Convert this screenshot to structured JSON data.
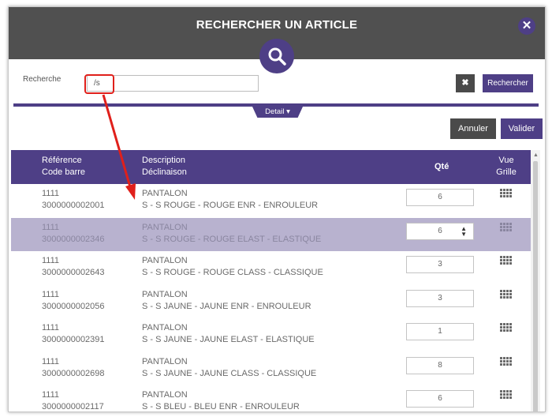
{
  "dialog": {
    "title": "RECHERCHER UN ARTICLE",
    "close_label": "✕",
    "search_label": "Recherche",
    "search_value": "/s",
    "clear_label": "✖",
    "search_button": "Rechercher",
    "detail_tab": "Detail ▾",
    "cancel_button": "Annuler",
    "validate_button": "Valider"
  },
  "table": {
    "headers": {
      "ref_line1": "Référence",
      "ref_line2": "Code barre",
      "desc_line1": "Description",
      "desc_line2": "Déclinaison",
      "qte": "Qté",
      "vue_line1": "Vue",
      "vue_line2": "Grille"
    },
    "rows": [
      {
        "ref": "1111",
        "barcode": "3000000002001",
        "desc": "PANTALON",
        "variant": "S - S ROUGE - ROUGE ENR - ENROULEUR",
        "qty": "6",
        "selected": false
      },
      {
        "ref": "1111",
        "barcode": "3000000002346",
        "desc": "PANTALON",
        "variant": "S - S ROUGE - ROUGE ELAST - ELASTIQUE",
        "qty": "6",
        "selected": true
      },
      {
        "ref": "1111",
        "barcode": "3000000002643",
        "desc": "PANTALON",
        "variant": "S - S ROUGE - ROUGE CLASS - CLASSIQUE",
        "qty": "3",
        "selected": false
      },
      {
        "ref": "1111",
        "barcode": "3000000002056",
        "desc": "PANTALON",
        "variant": "S - S JAUNE - JAUNE ENR - ENROULEUR",
        "qty": "3",
        "selected": false
      },
      {
        "ref": "1111",
        "barcode": "3000000002391",
        "desc": "PANTALON",
        "variant": "S - S JAUNE - JAUNE ELAST - ELASTIQUE",
        "qty": "1",
        "selected": false
      },
      {
        "ref": "1111",
        "barcode": "3000000002698",
        "desc": "PANTALON",
        "variant": "S - S JAUNE - JAUNE CLASS - CLASSIQUE",
        "qty": "8",
        "selected": false
      },
      {
        "ref": "1111",
        "barcode": "3000000002117",
        "desc": "PANTALON",
        "variant": "S - S BLEU - BLEU ENR - ENROULEUR",
        "qty": "6",
        "selected": false
      }
    ]
  },
  "colors": {
    "accent": "#4e3f86",
    "header_bg": "#505050",
    "annotation_red": "#e0201b",
    "selected_row": "#b8b2cf"
  },
  "icons": {
    "search": "search-icon",
    "close": "close-icon",
    "grid": "grid-icon"
  }
}
